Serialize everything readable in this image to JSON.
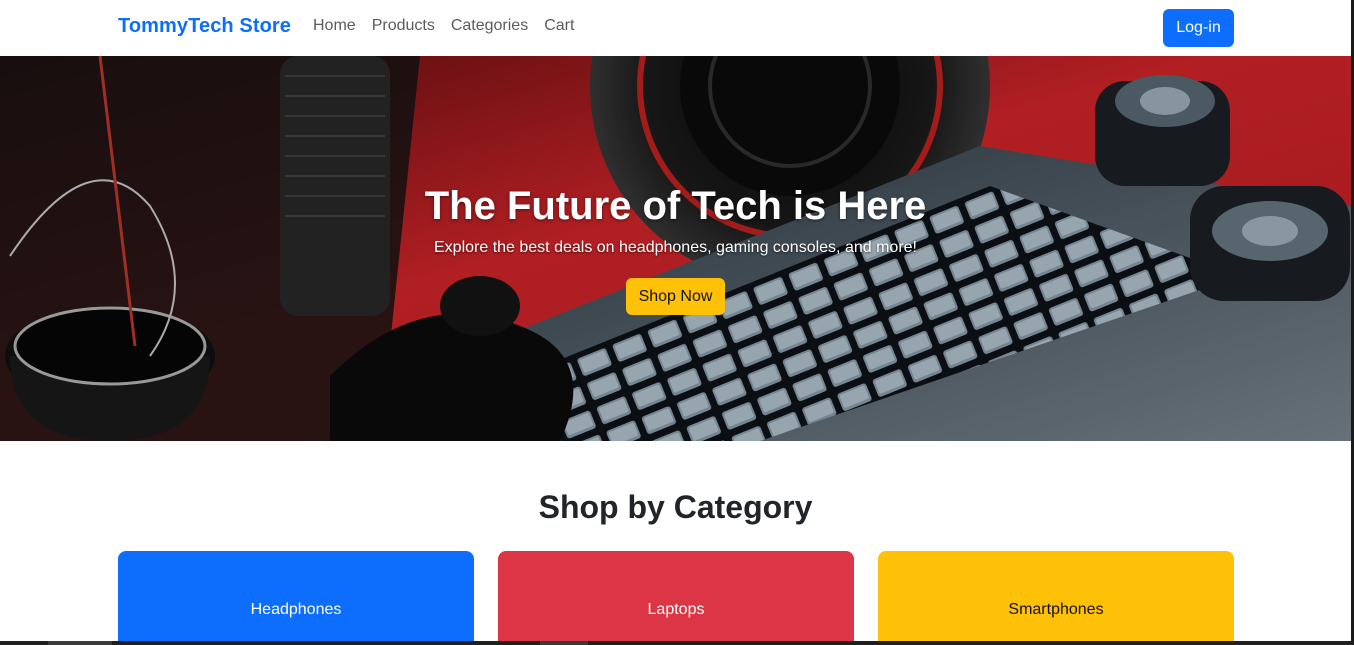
{
  "navbar": {
    "brand": "TommyTech Store",
    "links": [
      "Home",
      "Products",
      "Categories",
      "Cart"
    ],
    "login_label": "Log-in"
  },
  "hero": {
    "title": "The Future of Tech is Here",
    "subtitle": "Explore the best deals on headphones, gaming consoles, and more!",
    "cta_label": "Shop Now"
  },
  "categories": {
    "title": "Shop by Category",
    "items": [
      "Headphones",
      "Laptops",
      "Smartphones"
    ]
  },
  "colors": {
    "primary": "#0d6efd",
    "danger": "#dc3545",
    "warning": "#ffc107",
    "hero_red": "#d8262b"
  }
}
